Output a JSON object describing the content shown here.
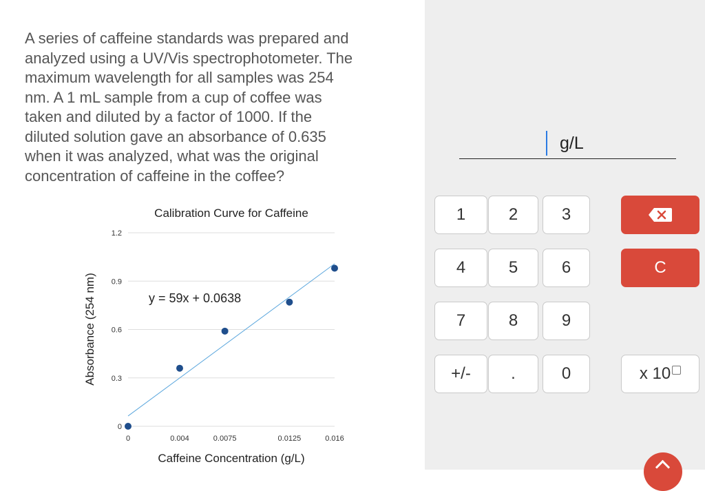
{
  "question": {
    "lines": [
      "A series of caffeine standards was prepared and",
      "analyzed using a UV/Vis spectrophotometer. The",
      "maximum wavelength for all samples was 254",
      "nm. A 1 mL sample from a cup of coffee was",
      "taken and diluted by a factor of 1000. If the",
      "diluted solution gave an absorbance of 0.635",
      "when it was analyzed, what was the original",
      "concentration of caffeine in the coffee?"
    ]
  },
  "chart_data": {
    "type": "scatter",
    "title": "Calibration Curve for Caffeine",
    "xlabel": "Caffeine Concentration (g/L)",
    "ylabel": "Absorbance (254 nm)",
    "x_ticks": [
      "0",
      "0.004",
      "0.0075",
      "0.0125",
      "0.016"
    ],
    "y_ticks": [
      "0",
      "0.3",
      "0.6",
      "0.9",
      "1.2"
    ],
    "xlim": [
      0,
      0.016
    ],
    "ylim": [
      0,
      1.2
    ],
    "grid": true,
    "points": [
      {
        "x": 0,
        "y": 0
      },
      {
        "x": 0.004,
        "y": 0.36
      },
      {
        "x": 0.0075,
        "y": 0.59
      },
      {
        "x": 0.0125,
        "y": 0.77
      },
      {
        "x": 0.016,
        "y": 0.98
      }
    ],
    "trendline": {
      "slope": 59,
      "intercept": 0.0638,
      "label": "y = 59x + 0.0638"
    },
    "colors": {
      "points": "#1f4e8c",
      "line": "#5aa6dd",
      "grid": "#dddddd"
    }
  },
  "answer": {
    "unit": "g/L",
    "value": ""
  },
  "keypad": {
    "keys": [
      "1",
      "2",
      "3",
      "4",
      "5",
      "6",
      "7",
      "8",
      "9",
      "+/-",
      ".",
      "0"
    ],
    "backspace_icon": "backspace-icon",
    "clear_label": "C",
    "exponent_label": "x 10"
  },
  "colors": {
    "accent": "#d9493a",
    "panel": "#eeeeee"
  }
}
